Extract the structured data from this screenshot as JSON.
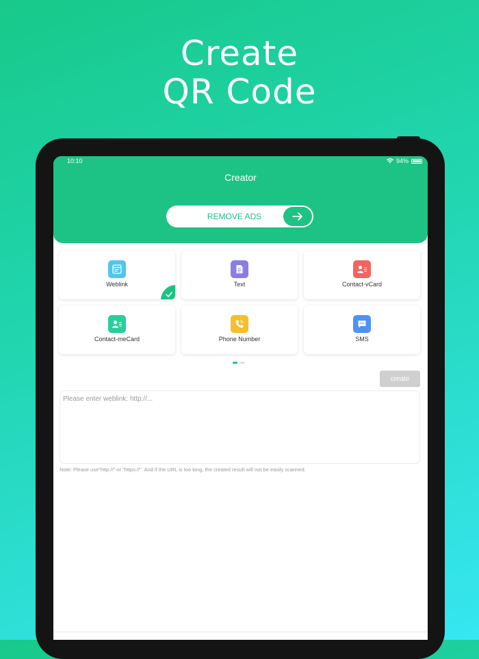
{
  "headline": {
    "line1": "Create",
    "line2": "QR Code"
  },
  "status_bar": {
    "time": "10:10",
    "battery": "94%"
  },
  "header": {
    "title": "Creator",
    "remove_ads_label": "REMOVE ADS"
  },
  "colors": {
    "accent": "#1cc385",
    "weblink": "#4fc6ef",
    "text": "#8a7de8",
    "vcard": "#f3645f",
    "mecard": "#26d09a",
    "phone": "#f7be2a",
    "sms": "#4e92f6"
  },
  "types": [
    {
      "label": "Weblink",
      "icon": "weblink-icon",
      "selected": true
    },
    {
      "label": "Text",
      "icon": "text-document-icon",
      "selected": false
    },
    {
      "label": "Contact-vCard",
      "icon": "contact-card-icon",
      "selected": false
    },
    {
      "label": "Contact-meCard",
      "icon": "contact-card-icon",
      "selected": false
    },
    {
      "label": "Phone Number",
      "icon": "phone-icon",
      "selected": false
    },
    {
      "label": "SMS",
      "icon": "message-icon",
      "selected": false
    }
  ],
  "pager": {
    "current": 1,
    "total": 2
  },
  "create_button": "create",
  "input": {
    "placeholder": "Please enter weblink:  http://..."
  },
  "note": "Note: Please use\"http://\" or \"https://\". And if the URL is too long, the created result will not be easily scanned."
}
